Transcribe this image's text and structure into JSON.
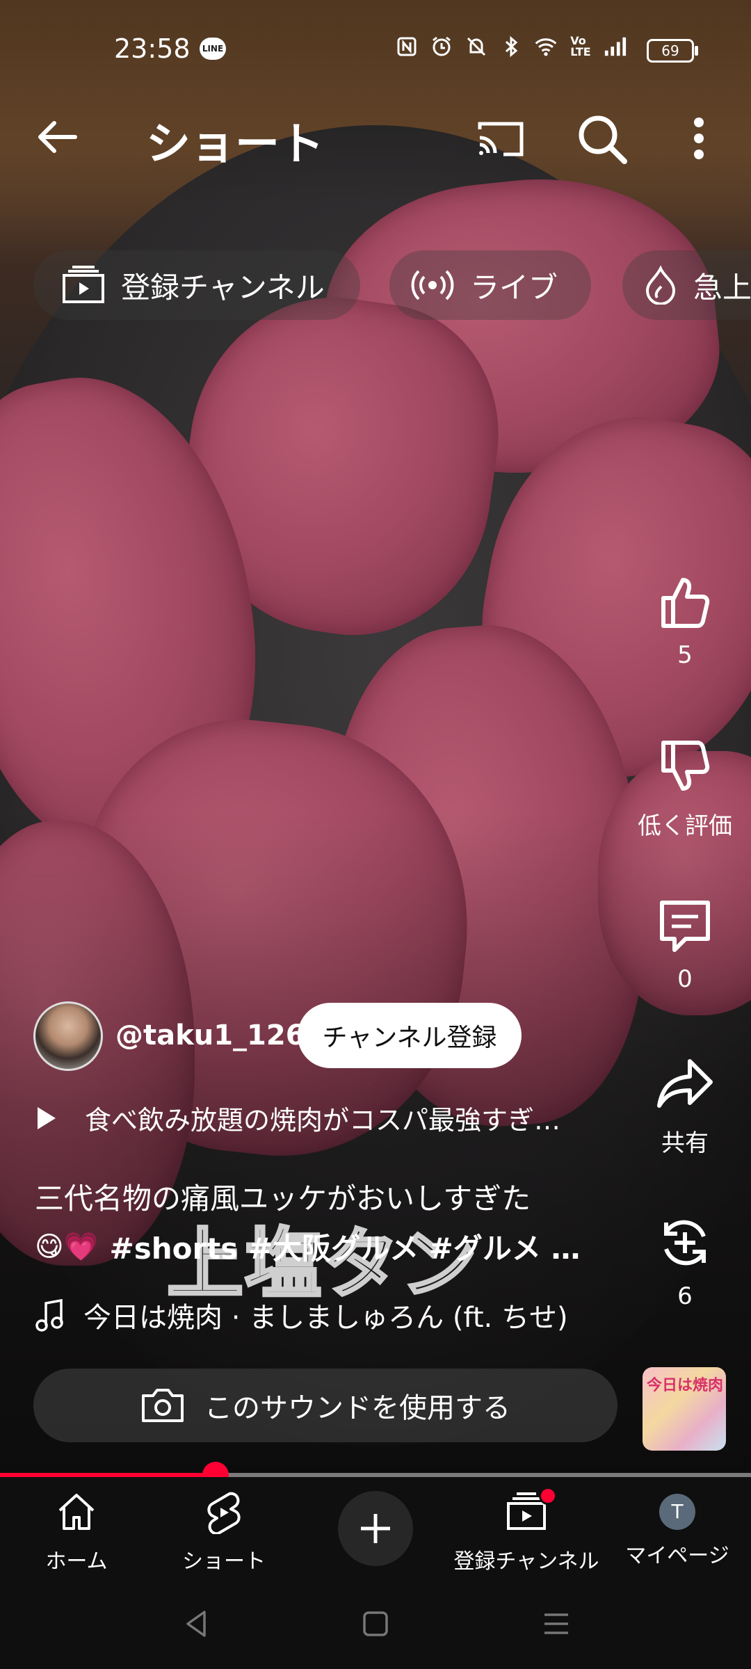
{
  "status_bar": {
    "time": "23:58",
    "line_badge": "LINE",
    "battery": "69",
    "icons": [
      "nfc-icon",
      "alarm-icon",
      "mute-icon",
      "bluetooth-icon",
      "wifi-icon",
      "volte-icon",
      "signal-icon"
    ]
  },
  "header": {
    "title": "ショート"
  },
  "chips": [
    {
      "label": "登録チャンネル",
      "icon": "subscriptions-icon"
    },
    {
      "label": "ライブ",
      "icon": "live-icon"
    },
    {
      "label": "急上",
      "icon": "trending-icon"
    }
  ],
  "actions": {
    "like_count": "5",
    "dislike_label": "低く評価",
    "comment_count": "0",
    "share_label": "共有",
    "remix_count": "6"
  },
  "channel": {
    "handle": "@taku1_126",
    "subscribe_label": "チャンネル登録"
  },
  "related_video": "食べ飲み放題の焼肉がコスパ最強すぎ…",
  "description": {
    "line1": "三代名物の痛風ユッケがおいしすぎた",
    "emoji": "😋💗",
    "tags": "#shorts #大阪グルメ #グルメ …"
  },
  "video_overlay_text": "上塩タン",
  "music": {
    "track": "今日は焼肉 · ましましゅろん (ft. ちせ)"
  },
  "sound": {
    "button_label": "このサウンドを使用する",
    "thumb_text": "今日は焼肉"
  },
  "progress": {
    "fraction": 0.287
  },
  "bottom_nav": {
    "home": "ホーム",
    "shorts": "ショート",
    "subscriptions": "登録チャンネル",
    "you": "マイページ",
    "you_initial": "T"
  },
  "colors": {
    "accent": "#ff0033",
    "background": "#0f0f0f"
  }
}
